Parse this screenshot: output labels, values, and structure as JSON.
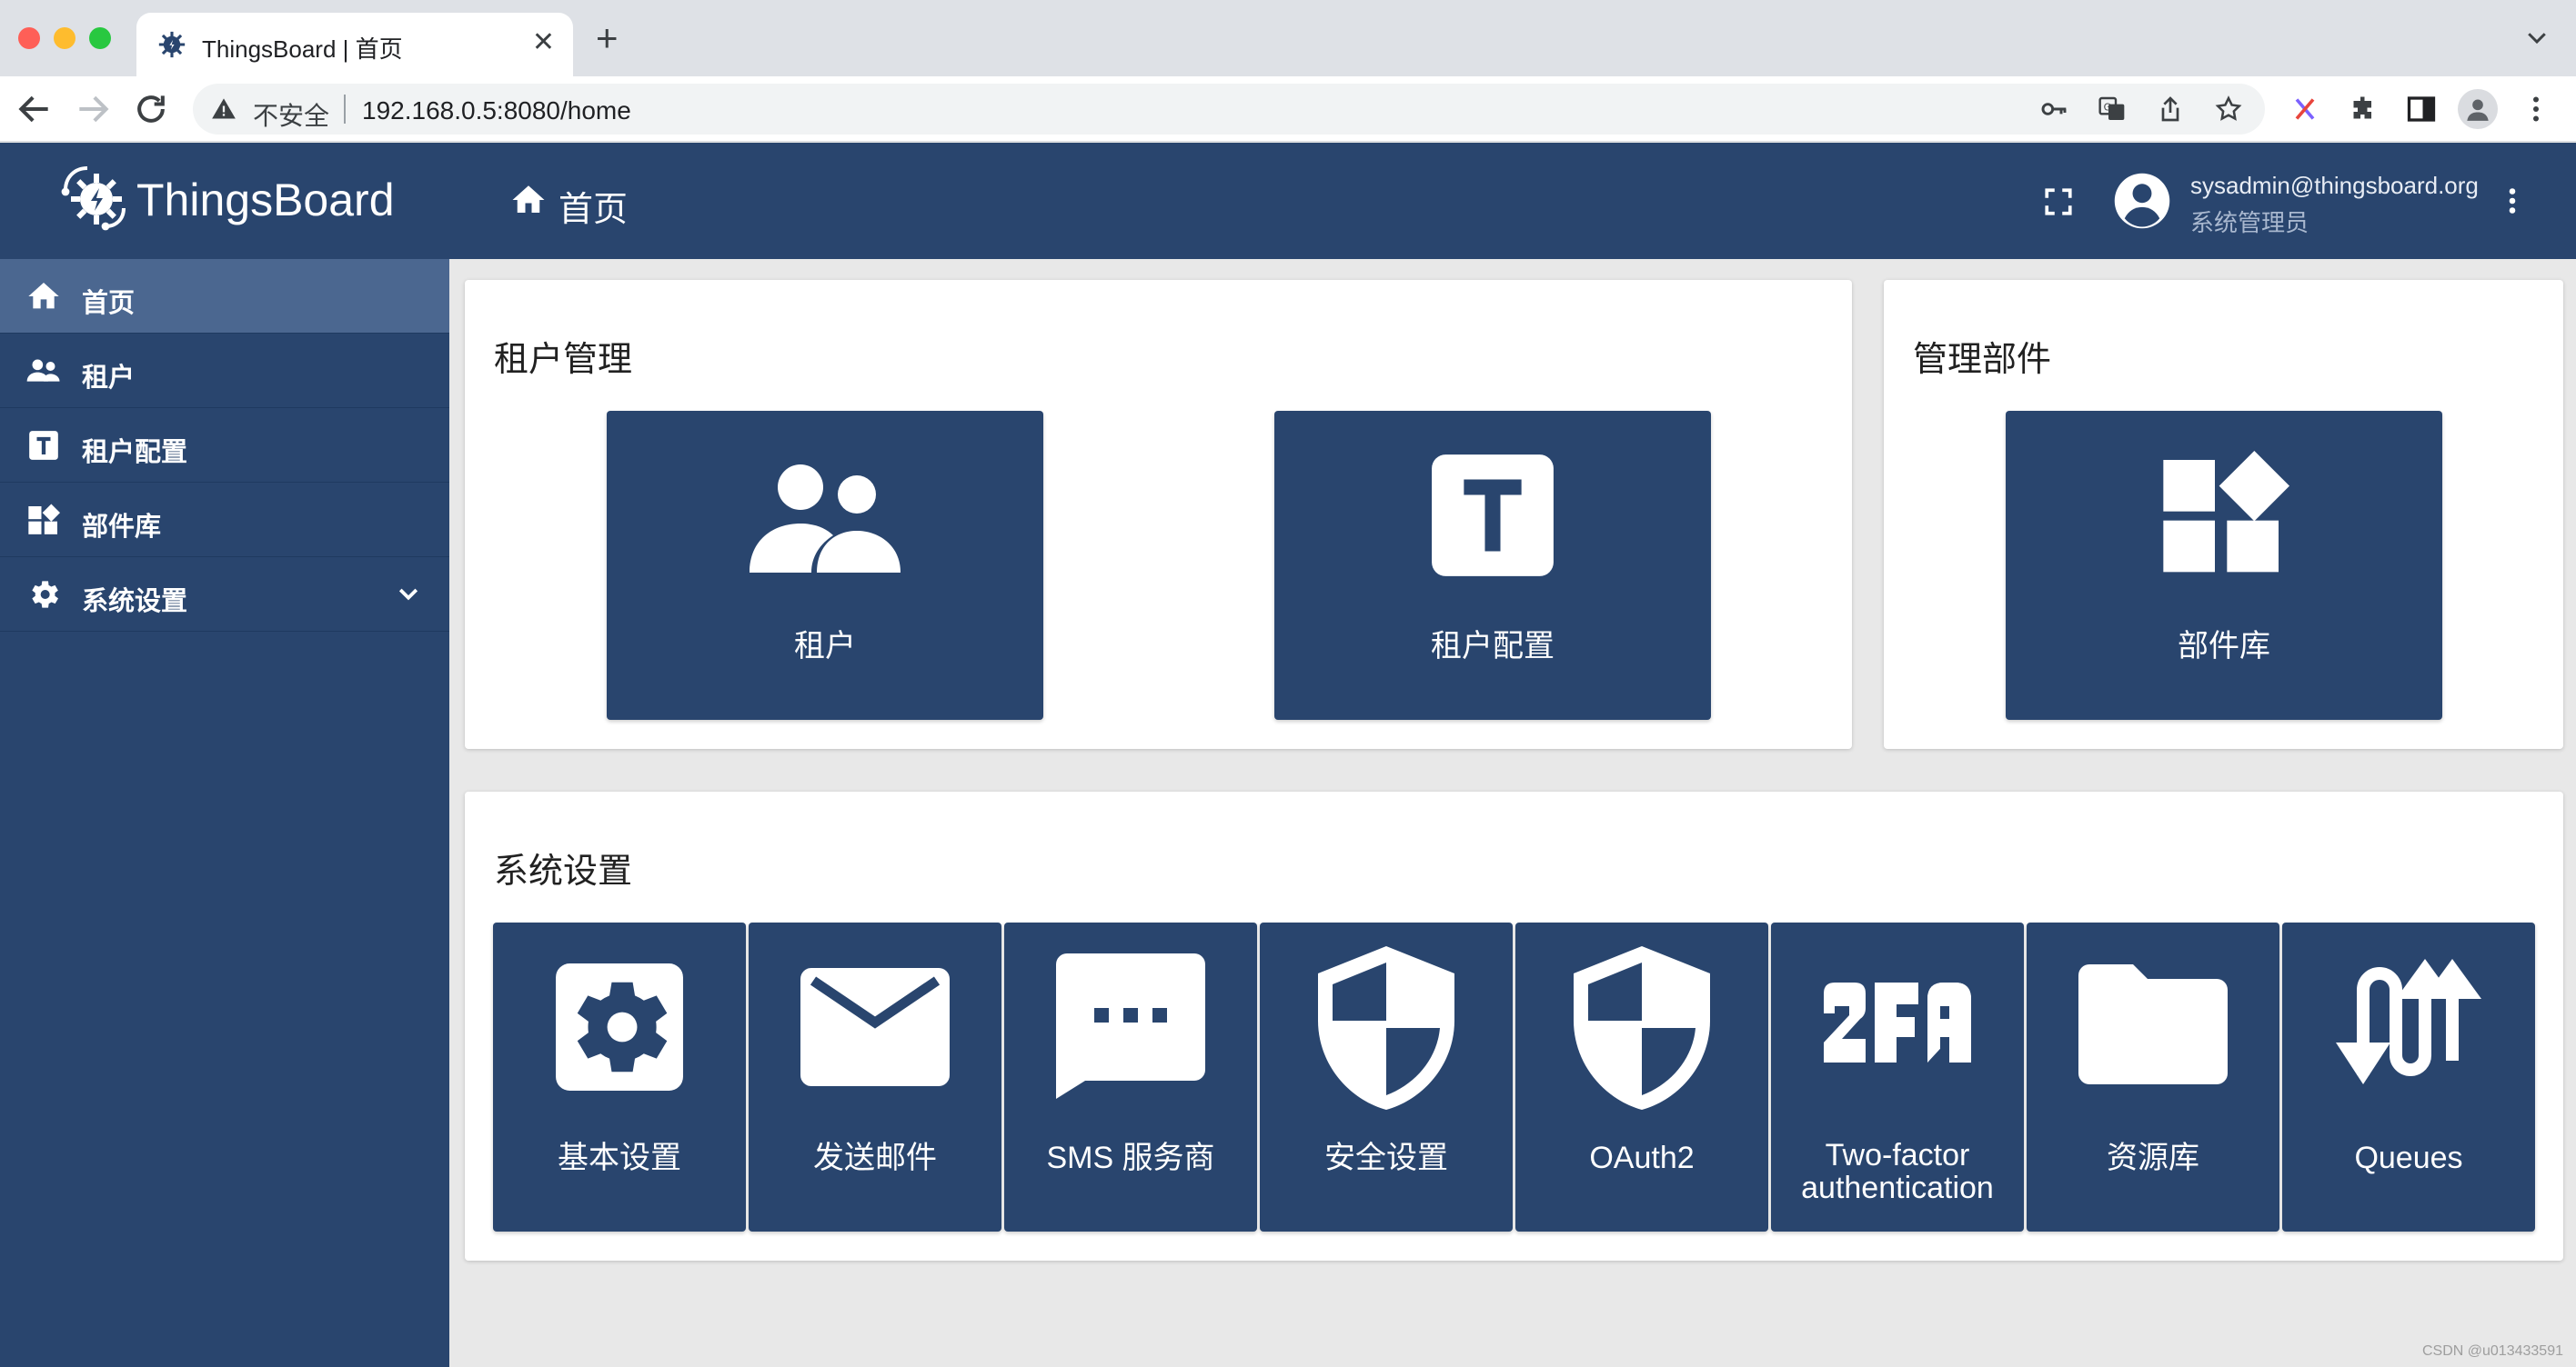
{
  "browser": {
    "tab_title": "ThingsBoard | 首页",
    "insecure_label": "不安全",
    "url": "192.168.0.5:8080/home"
  },
  "header": {
    "logo_text": "ThingsBoard",
    "page_title": "首页",
    "user_email": "sysadmin@thingsboard.org",
    "user_role": "系统管理员"
  },
  "sidebar": {
    "items": [
      {
        "label": "首页",
        "icon": "home-icon"
      },
      {
        "label": "租户",
        "icon": "people-icon"
      },
      {
        "label": "租户配置",
        "icon": "tenant-profile-icon"
      },
      {
        "label": "部件库",
        "icon": "widgets-icon"
      },
      {
        "label": "系统设置",
        "icon": "gear-icon"
      }
    ]
  },
  "main": {
    "tenant_card": {
      "title": "租户管理",
      "tiles": [
        {
          "label": "租户",
          "icon": "people-icon"
        },
        {
          "label": "租户配置",
          "icon": "tenant-profile-icon"
        }
      ]
    },
    "widgets_card": {
      "title": "管理部件",
      "tiles": [
        {
          "label": "部件库",
          "icon": "widgets-icon"
        }
      ]
    },
    "settings_card": {
      "title": "系统设置",
      "tiles": [
        {
          "label": "基本设置",
          "icon": "gear-icon"
        },
        {
          "label": "发送邮件",
          "icon": "mail-icon"
        },
        {
          "label": "SMS 服务商",
          "icon": "sms-icon"
        },
        {
          "label": "安全设置",
          "icon": "shield-icon"
        },
        {
          "label": "OAuth2",
          "icon": "shield-icon"
        },
        {
          "label": "Two-factor authentication",
          "icon": "2fa-icon"
        },
        {
          "label": "资源库",
          "icon": "folder-icon"
        },
        {
          "label": "Queues",
          "icon": "queues-icon"
        }
      ]
    }
  },
  "watermark": "CSDN @u013433591",
  "colors": {
    "primary": "#29456e",
    "sidebar_active": "#4b6790",
    "background": "#e8e8e8"
  }
}
